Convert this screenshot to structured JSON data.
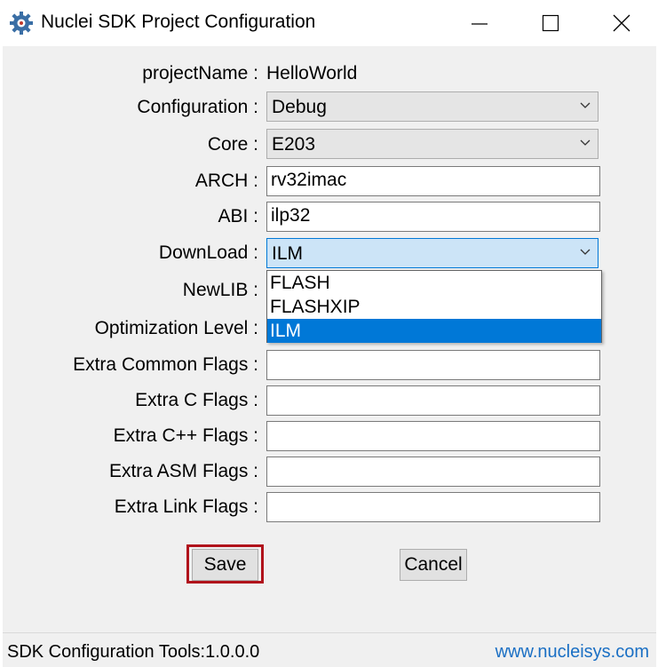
{
  "window": {
    "title": "Nuclei SDK Project Configuration",
    "icon": "gear-icon",
    "controls": [
      "minimize-icon",
      "maximize-icon",
      "close-icon"
    ]
  },
  "form": {
    "project_name": {
      "label": "projectName :",
      "value": "HelloWorld"
    },
    "configuration": {
      "label": "Configuration :",
      "value": "Debug"
    },
    "core": {
      "label": "Core :",
      "value": "E203"
    },
    "arch": {
      "label": "ARCH :",
      "value": "rv32imac"
    },
    "abi": {
      "label": "ABI :",
      "value": "ilp32"
    },
    "download": {
      "label": "DownLoad :",
      "value": "ILM",
      "options": [
        "FLASH",
        "FLASHXIP",
        "ILM"
      ],
      "selected": "ILM",
      "expanded": true
    },
    "newlib": {
      "label": "NewLIB :"
    },
    "optimization": {
      "label": "Optimization Level :"
    },
    "extra_common": {
      "label": "Extra Common Flags :",
      "value": ""
    },
    "extra_c": {
      "label": "Extra C Flags :",
      "value": ""
    },
    "extra_cpp": {
      "label": "Extra C++ Flags :",
      "value": ""
    },
    "extra_asm": {
      "label": "Extra ASM Flags :",
      "value": ""
    },
    "extra_link": {
      "label": "Extra Link Flags :",
      "value": ""
    }
  },
  "buttons": {
    "save": "Save",
    "cancel": "Cancel"
  },
  "status": {
    "left": "SDK Configuration Tools:1.0.0.0",
    "right": "www.nucleisys.com"
  },
  "colors": {
    "selection": "#0078d7",
    "highlight_box": "#b0121b",
    "link": "#1a6fc4",
    "client_background": "#f0f0f0"
  }
}
